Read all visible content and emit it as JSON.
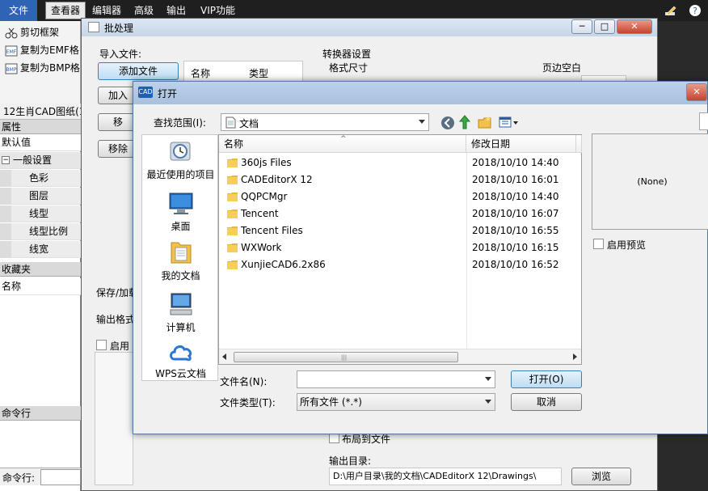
{
  "app": {
    "menu": [
      "文件",
      "查看器",
      "编辑器",
      "高级",
      "输出",
      "VIP功能"
    ],
    "toolbar": [
      "剪切框架",
      "复制为EMF格",
      "复制为BMP格"
    ],
    "tab": "12生肖CAD图纸(1",
    "properties_header": "属性",
    "default_value": "默认值",
    "group": "一般设置",
    "props": [
      "色彩",
      "图层",
      "线型",
      "线型比例",
      "线宽"
    ],
    "favorites_header": "收藏夹",
    "favorites_col": "名称",
    "cmdline_header": "命令行",
    "cmd_prompt": "命令行:"
  },
  "batch": {
    "title": "批处理",
    "import_label": "导入文件:",
    "add_files": "添加文件",
    "col_name": "名称",
    "col_type": "类型",
    "btn_add_short": "加入",
    "btn_move_short": "移",
    "btn_remove_short": "移除",
    "save_label": "保存/加载",
    "output_format_label": "输出格式",
    "enable_label": "启用",
    "converter_label": "转换器设置",
    "format_size": "格式尺寸",
    "page_margin": "页边空白",
    "layout_to_file": "布局到文件",
    "output_dir_label": "输出目录:",
    "output_dir": "D:\\用户目录\\我的文档\\CADEditorX 12\\Drawings\\",
    "browse": "浏览"
  },
  "open": {
    "title": "打开",
    "lookin_label": "查找范围(I):",
    "lookin_value": "文档",
    "places": [
      "最近使用的项目",
      "桌面",
      "我的文档",
      "计算机",
      "WPS云文档"
    ],
    "columns": [
      "名称",
      "修改日期"
    ],
    "files": [
      {
        "name": "360js Files",
        "date": "2018/10/10 14:40"
      },
      {
        "name": "CADEditorX 12",
        "date": "2018/10/10 16:01"
      },
      {
        "name": "QQPCMgr",
        "date": "2018/10/10 14:40"
      },
      {
        "name": "Tencent",
        "date": "2018/10/10 16:07"
      },
      {
        "name": "Tencent Files",
        "date": "2018/10/10 16:55"
      },
      {
        "name": "WXWork",
        "date": "2018/10/10 16:15"
      },
      {
        "name": "XunjieCAD6.2x86",
        "date": "2018/10/10 16:52"
      }
    ],
    "preview_none": "(None)",
    "enable_preview": "启用预览",
    "filename_label": "文件名(N):",
    "filename_value": "",
    "filetype_label": "文件类型(T):",
    "filetype_value": "所有文件 (*.*)",
    "open_btn": "打开(O)",
    "cancel_btn": "取消"
  },
  "colors": {
    "accent": "#2f63b3",
    "folder": "#e8b93a"
  }
}
